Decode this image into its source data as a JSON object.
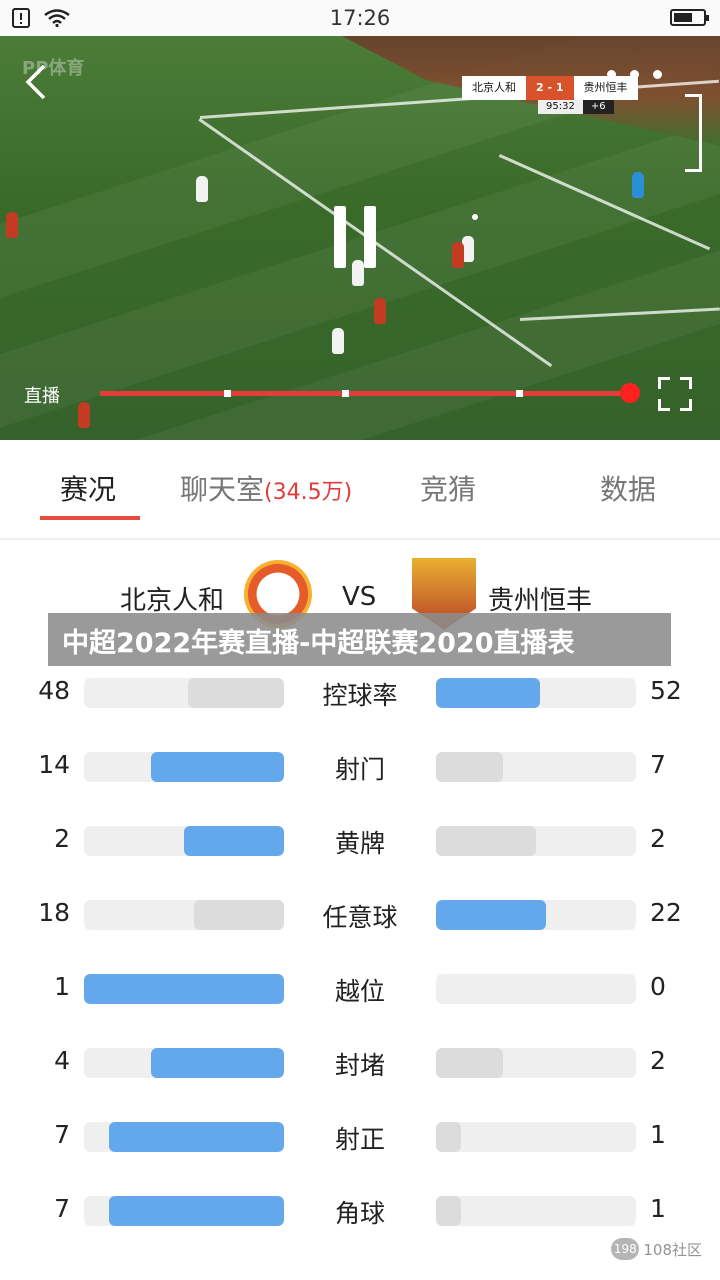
{
  "status_bar": {
    "time": "17:26"
  },
  "video": {
    "watermark": "PP体育",
    "live_label": "直播",
    "scoreboard": {
      "home": "北京人和",
      "score": "2 - 1",
      "away": "贵州恒丰",
      "clock": "95:32",
      "added": "+6"
    }
  },
  "tabs": [
    {
      "label": "赛况",
      "active": true
    },
    {
      "label": "聊天室",
      "count": "(34.5万)"
    },
    {
      "label": "竞猜"
    },
    {
      "label": "数据"
    }
  ],
  "match": {
    "home": "北京人和",
    "vs": "VS",
    "away": "贵州恒丰"
  },
  "banner": {
    "text": "中超2022年赛直播-中超联赛2020直播表"
  },
  "stats": [
    {
      "label": "控球率",
      "home": 48,
      "away": 52
    },
    {
      "label": "射门",
      "home": 14,
      "away": 7
    },
    {
      "label": "黄牌",
      "home": 2,
      "away": 2
    },
    {
      "label": "任意球",
      "home": 18,
      "away": 22
    },
    {
      "label": "越位",
      "home": 1,
      "away": 0
    },
    {
      "label": "封堵",
      "home": 4,
      "away": 2
    },
    {
      "label": "射正",
      "home": 7,
      "away": 1
    },
    {
      "label": "角球",
      "home": 7,
      "away": 1
    }
  ],
  "footer": {
    "badge": "198",
    "text": "108社区"
  },
  "colors": {
    "accent": "#e84b3c",
    "bar_win": "#64a8ec",
    "bar_lose": "#dcdcdc"
  }
}
